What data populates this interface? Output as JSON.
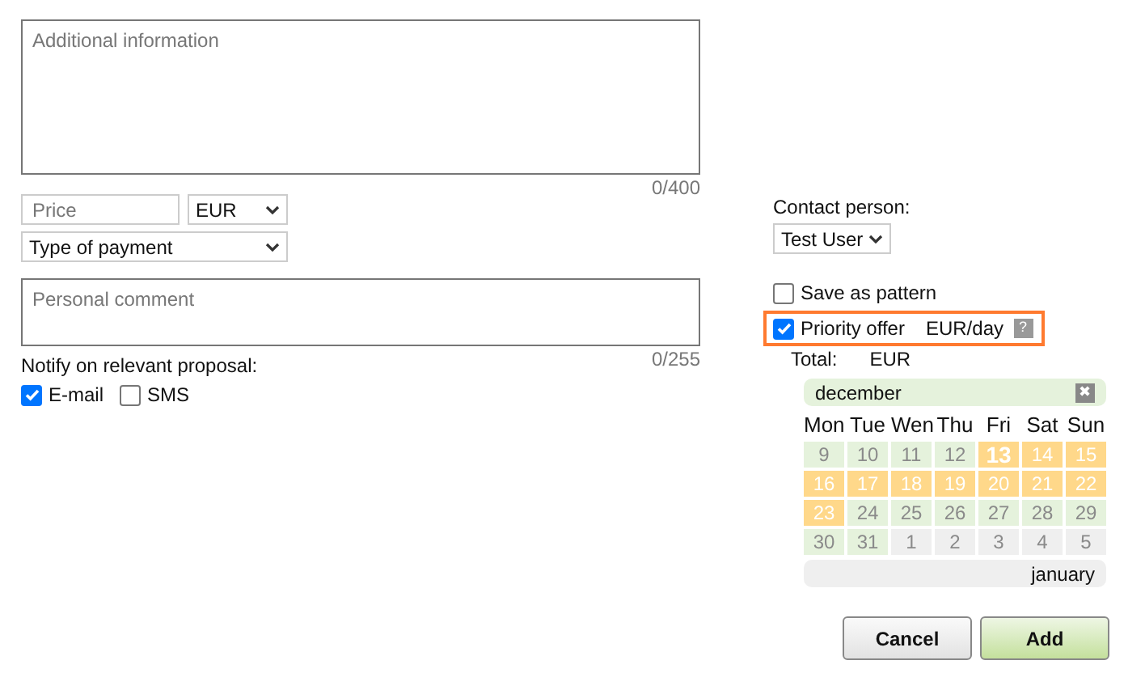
{
  "additional_info": {
    "placeholder": "Additional information",
    "counter": "0/400"
  },
  "price": {
    "placeholder": "Price",
    "currency": "EUR"
  },
  "payment": {
    "value": "Type of payment"
  },
  "comment": {
    "placeholder": "Personal comment",
    "counter": "0/255"
  },
  "notify": {
    "label": "Notify on relevant proposal:",
    "options": [
      {
        "label": "E-mail",
        "checked": true
      },
      {
        "label": "SMS",
        "checked": false
      }
    ]
  },
  "contact": {
    "label": "Contact person:",
    "value": "Test User"
  },
  "save_pattern": {
    "label": "Save as pattern",
    "checked": false
  },
  "priority": {
    "label": "Priority offer",
    "unit": "EUR/day",
    "help": "?",
    "checked": true,
    "highlighted": true
  },
  "total": {
    "label": "Total:",
    "currency": "EUR"
  },
  "calendar": {
    "month": "december",
    "close": "✖",
    "next_month": "january",
    "weekdays": [
      "Mon",
      "Tue",
      "Wen",
      "Thu",
      "Fri",
      "Sat",
      "Sun"
    ],
    "days": [
      {
        "label": "9",
        "kind": "past"
      },
      {
        "label": "10",
        "kind": "past"
      },
      {
        "label": "11",
        "kind": "past"
      },
      {
        "label": "12",
        "kind": "past"
      },
      {
        "label": "13",
        "kind": "today"
      },
      {
        "label": "14",
        "kind": "open"
      },
      {
        "label": "15",
        "kind": "open"
      },
      {
        "label": "16",
        "kind": "open"
      },
      {
        "label": "17",
        "kind": "open"
      },
      {
        "label": "18",
        "kind": "open"
      },
      {
        "label": "19",
        "kind": "open"
      },
      {
        "label": "20",
        "kind": "open"
      },
      {
        "label": "21",
        "kind": "open"
      },
      {
        "label": "22",
        "kind": "open"
      },
      {
        "label": "23",
        "kind": "open"
      },
      {
        "label": "24",
        "kind": "past"
      },
      {
        "label": "25",
        "kind": "past"
      },
      {
        "label": "26",
        "kind": "past"
      },
      {
        "label": "27",
        "kind": "past"
      },
      {
        "label": "28",
        "kind": "past"
      },
      {
        "label": "29",
        "kind": "past"
      },
      {
        "label": "30",
        "kind": "past"
      },
      {
        "label": "31",
        "kind": "past"
      },
      {
        "label": "1",
        "kind": "other"
      },
      {
        "label": "2",
        "kind": "other"
      },
      {
        "label": "3",
        "kind": "other"
      },
      {
        "label": "4",
        "kind": "other"
      },
      {
        "label": "5",
        "kind": "other"
      }
    ]
  },
  "buttons": [
    {
      "label": "Cancel",
      "kind": "secondary"
    },
    {
      "label": "Add",
      "kind": "primary"
    }
  ]
}
